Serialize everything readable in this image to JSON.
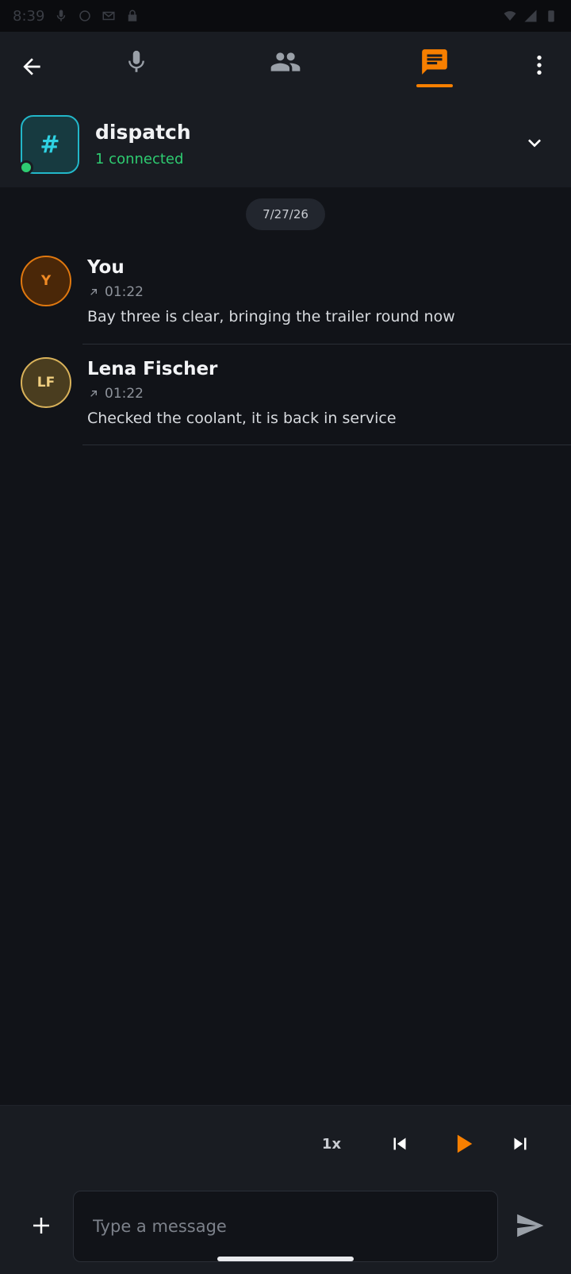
{
  "status_bar": {
    "time": "8:39"
  },
  "nav": {
    "back_icon": "arrow-left-icon",
    "tabs": [
      {
        "id": "voice",
        "icon": "microphone-icon",
        "active": false
      },
      {
        "id": "members",
        "icon": "people-icon",
        "active": false
      },
      {
        "id": "chat",
        "icon": "chat-icon",
        "active": true
      }
    ],
    "more_icon": "more-vertical-icon"
  },
  "channel": {
    "symbol": "#",
    "name": "dispatch",
    "status": "1 connected",
    "online": true
  },
  "date_chip": "7/27/26",
  "messages": [
    {
      "initials": "Y",
      "author": "You",
      "time": "01:22",
      "text": "Bay three is clear, bringing the trailer round now"
    },
    {
      "initials": "LF",
      "author": "Lena Fischer",
      "time": "01:22",
      "text": "Checked the coolant, it is back in service"
    }
  ],
  "playback": {
    "speed": "1x"
  },
  "composer": {
    "placeholder": "Type a message"
  },
  "colors": {
    "accent": "#f77f00",
    "online": "#2ecc71",
    "channel_accent": "#22b7c9",
    "background": "#111318",
    "panel": "#191c22"
  }
}
